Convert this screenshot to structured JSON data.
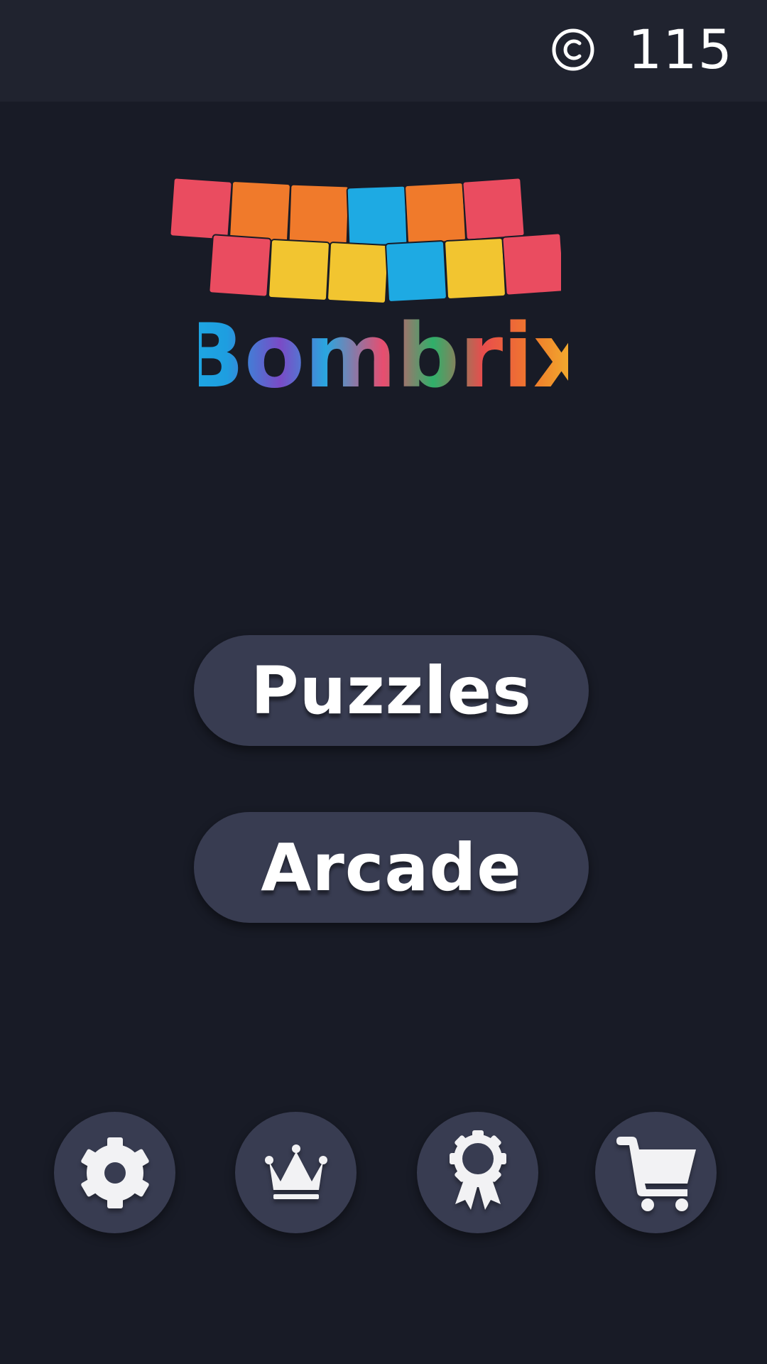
{
  "header": {
    "coin_icon": "copyright-coin-icon",
    "coin_count": "115"
  },
  "logo": {
    "title": "Bombrix",
    "block_colors": {
      "red": "#ea4c60",
      "orange": "#f07a2b",
      "blue": "#1eaae3",
      "yellow": "#f2c530"
    },
    "row1": [
      "red",
      "orange",
      "orange",
      "blue",
      "orange",
      "red"
    ],
    "row2": [
      "red",
      "yellow",
      "yellow",
      "blue",
      "yellow",
      "red"
    ]
  },
  "menu": {
    "puzzles_label": "Puzzles",
    "arcade_label": "Arcade"
  },
  "bottom_bar": {
    "icons": [
      "gear-icon",
      "crown-icon",
      "ribbon-award-icon",
      "shopping-cart-icon"
    ]
  },
  "colors": {
    "background": "#181b26",
    "topbar": "#20232f",
    "button": "#383c51",
    "text": "#ffffff"
  }
}
